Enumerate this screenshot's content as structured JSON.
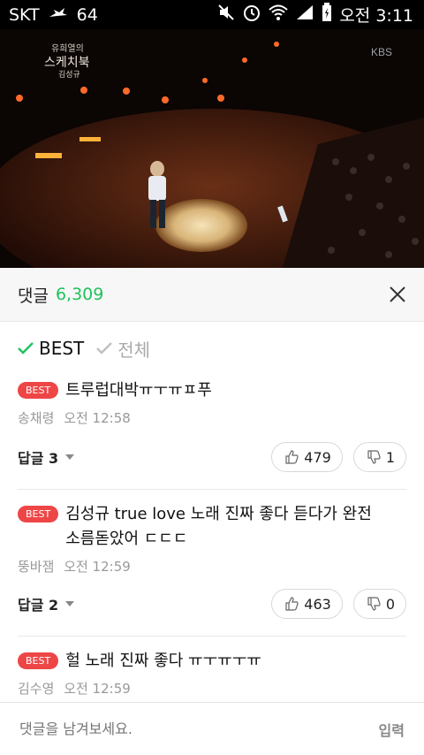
{
  "statusbar": {
    "carrier": "SKT",
    "notification_count": "64",
    "time": "오전 3:11",
    "icons": [
      "bird-icon",
      "mute-icon",
      "alarm-icon",
      "wifi-icon",
      "signal-icon",
      "battery-icon"
    ]
  },
  "video": {
    "broadcaster": "KBS",
    "show_logo_line1": "유희열의",
    "show_logo_line2": "스케치북",
    "show_logo_line3": "김성규"
  },
  "comments_header": {
    "title": "댓글",
    "count": "6,309",
    "count_color": "#1ec35b"
  },
  "tabs": [
    {
      "label": "BEST",
      "active": true
    },
    {
      "label": "전체",
      "active": false
    }
  ],
  "comments": [
    {
      "badge": "BEST",
      "text": "트루럽대박ㅠㅜㅠㅍ푸",
      "author": "송채령",
      "time": "오전 12:58",
      "reply_label": "답글 3",
      "likes": "479",
      "dislikes": "1"
    },
    {
      "badge": "BEST",
      "text": "김성규 true love 노래 진짜 좋다 듣다가 완전 소름돋았어 ㄷㄷㄷ",
      "author": "뚱바잼",
      "time": "오전 12:59",
      "reply_label": "답글 2",
      "likes": "463",
      "dislikes": "0"
    },
    {
      "badge": "BEST",
      "text": "헐 노래 진짜 좋다 ㅠㅜㅠㅜㅠ",
      "author": "김수영",
      "time": "오전 12:59"
    }
  ],
  "input": {
    "placeholder": "댓글을 남겨보세요.",
    "submit_label": "입력"
  },
  "colors": {
    "badge": "#ee4646",
    "accent_green": "#1ec35b"
  }
}
